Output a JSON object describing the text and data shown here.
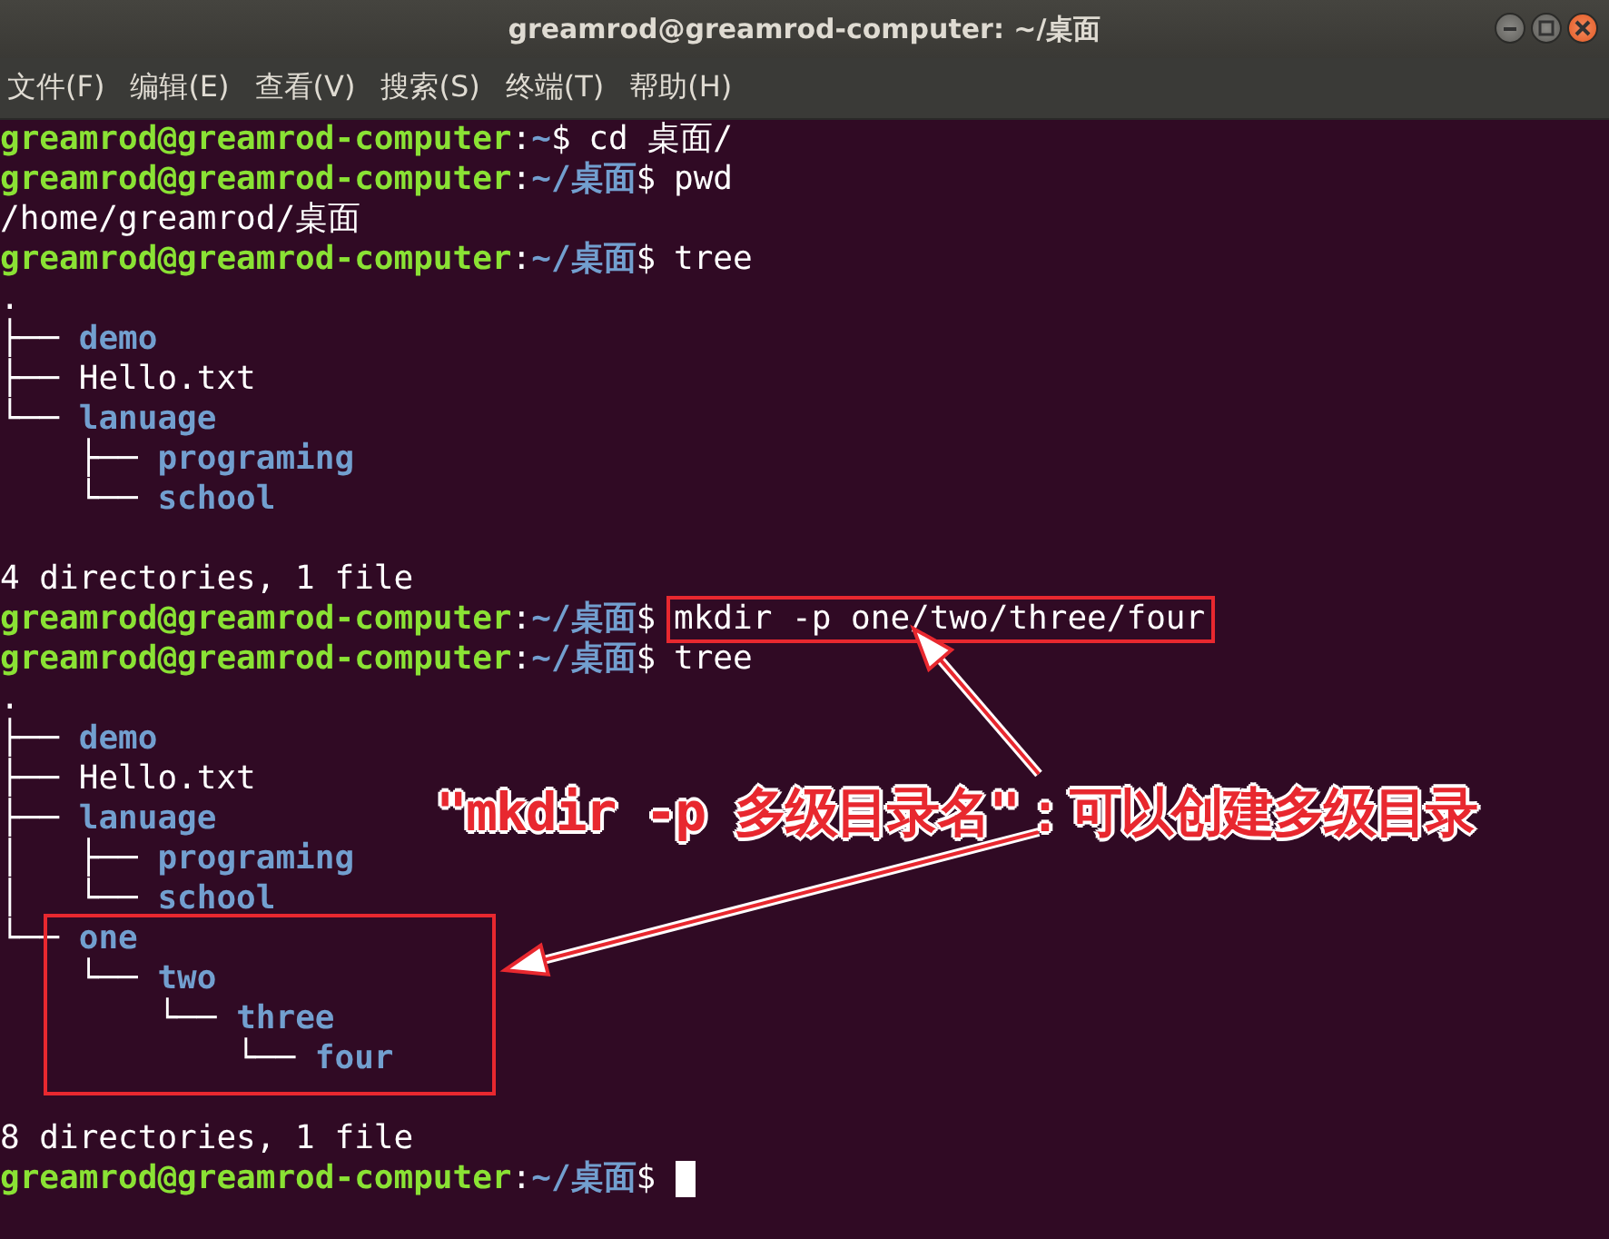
{
  "window": {
    "title": "greamrod@greamrod-computer: ~/桌面"
  },
  "menu": [
    "文件(F)",
    "编辑(E)",
    "查看(V)",
    "搜索(S)",
    "终端(T)",
    "帮助(H)"
  ],
  "lines": [
    {
      "kind": "prompt",
      "user": "greamrod@greamrod-computer",
      "sep": ":",
      "path": "~",
      "sign": "$",
      "command": "cd 桌面/"
    },
    {
      "kind": "prompt",
      "user": "greamrod@greamrod-computer",
      "sep": ":",
      "path": "~/桌面",
      "sign": "$",
      "command": "pwd"
    },
    {
      "kind": "output",
      "text": "/home/greamrod/桌面"
    },
    {
      "kind": "prompt",
      "user": "greamrod@greamrod-computer",
      "sep": ":",
      "path": "~/桌面",
      "sign": "$",
      "command": "tree"
    },
    {
      "kind": "output",
      "text": "."
    },
    {
      "kind": "tree",
      "branch": "├──",
      "name": "demo",
      "dir": true
    },
    {
      "kind": "tree",
      "branch": "├──",
      "name": "Hello.txt",
      "dir": false
    },
    {
      "kind": "tree",
      "branch": "└──",
      "name": "lanuage",
      "dir": true
    },
    {
      "kind": "tree",
      "branch": "    ├──",
      "name": "programing",
      "dir": true
    },
    {
      "kind": "tree",
      "branch": "    └──",
      "name": "school",
      "dir": true
    },
    {
      "kind": "blank"
    },
    {
      "kind": "output",
      "text": "4 directories, 1 file"
    },
    {
      "kind": "prompt",
      "user": "greamrod@greamrod-computer",
      "sep": ":",
      "path": "~/桌面",
      "sign": "$",
      "command": "mkdir -p one/two/three/four",
      "highlight": true
    },
    {
      "kind": "prompt",
      "user": "greamrod@greamrod-computer",
      "sep": ":",
      "path": "~/桌面",
      "sign": "$",
      "command": "tree"
    },
    {
      "kind": "output",
      "text": "."
    },
    {
      "kind": "tree",
      "branch": "├──",
      "name": "demo",
      "dir": true
    },
    {
      "kind": "tree",
      "branch": "├──",
      "name": "Hello.txt",
      "dir": false
    },
    {
      "kind": "tree",
      "branch": "├──",
      "name": "lanuage",
      "dir": true
    },
    {
      "kind": "tree",
      "branch": "│   ├──",
      "name": "programing",
      "dir": true
    },
    {
      "kind": "tree",
      "branch": "│   └──",
      "name": "school",
      "dir": true
    },
    {
      "kind": "tree",
      "branch": "└──",
      "name": "one",
      "dir": true
    },
    {
      "kind": "tree",
      "branch": "    └──",
      "name": "two",
      "dir": true
    },
    {
      "kind": "tree",
      "branch": "        └──",
      "name": "three",
      "dir": true
    },
    {
      "kind": "tree",
      "branch": "            └──",
      "name": "four",
      "dir": true
    },
    {
      "kind": "blank"
    },
    {
      "kind": "output",
      "text": "8 directories, 1 file"
    },
    {
      "kind": "prompt",
      "user": "greamrod@greamrod-computer",
      "sep": ":",
      "path": "~/桌面",
      "sign": "$",
      "cursor": true
    }
  ],
  "annotation": {
    "callout": "\"mkdir -p 多级目录名\"：可以创建多级目录"
  }
}
